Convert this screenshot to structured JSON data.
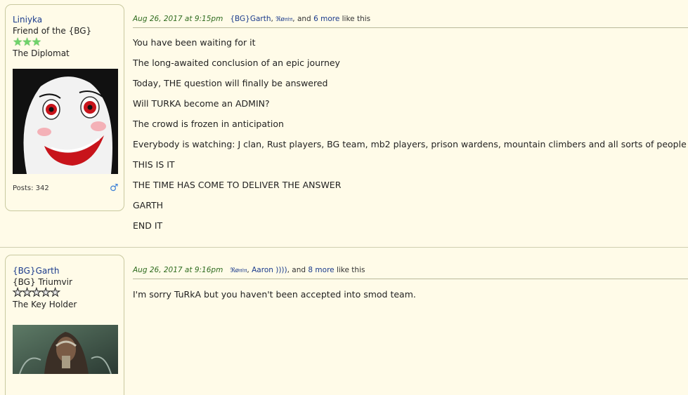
{
  "posts": [
    {
      "author": {
        "name": "Liniyka",
        "rank_line1": "Friend of the {BG}",
        "stars": "★★★",
        "rank_line2": "The Diplomat",
        "posts_label": "Posts: 342",
        "gender_icon": "♂"
      },
      "meta": {
        "date": "Aug 26, 2017 at 9:15pm",
        "likers": [
          "{BG}Garth",
          "ℜø𝔫𝔦𝔫"
        ],
        "sep": ", ",
        "and_text": ", and ",
        "more": "6 more",
        "suffix": " like this"
      },
      "lines": [
        "You have been waiting for it",
        "The long-awaited conclusion of an epic journey",
        "Today, THE question will finally be answered",
        "Will TURKA become an ADMIN?",
        "The crowd is frozen in anticipation",
        "Everybody is watching: J clan, Rust players, BG team, mb2 players, prison wardens, mountain climbers and all sorts of people",
        "THIS IS IT",
        "THE TIME HAS COME TO DELIVER THE ANSWER",
        "GARTH",
        "END IT"
      ]
    },
    {
      "author": {
        "name": "{BG}Garth",
        "rank_line1": "{BG} Triumvir",
        "stars": "★★★★★",
        "rank_line2": "The Key Holder"
      },
      "meta": {
        "date": "Aug 26, 2017 at 9:16pm",
        "likers": [
          "ℜø𝔫𝔦𝔫",
          "Aaron ))))"
        ],
        "sep": ", ",
        "and_text": ", and ",
        "more": "8 more",
        "suffix": " like this"
      },
      "lines": [
        "I'm sorry TuRkA but you haven't been accepted into smod team."
      ]
    }
  ]
}
